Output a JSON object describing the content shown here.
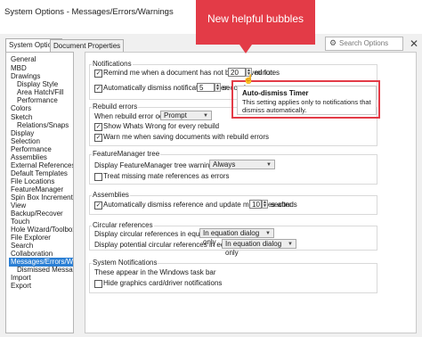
{
  "window": {
    "title": "System Options - Messages/Errors/Warnings",
    "close": "✕"
  },
  "tabs": [
    {
      "label": "System Options"
    },
    {
      "label": "Document Properties"
    }
  ],
  "search": {
    "placeholder": "Search Options",
    "icon": "gear-icon"
  },
  "sidebar": {
    "items": [
      {
        "label": "General"
      },
      {
        "label": "MBD"
      },
      {
        "label": "Drawings"
      },
      {
        "label": "Display Style"
      },
      {
        "label": "Area Hatch/Fill"
      },
      {
        "label": "Performance"
      },
      {
        "label": "Colors"
      },
      {
        "label": "Sketch"
      },
      {
        "label": "Relations/Snaps"
      },
      {
        "label": "Display"
      },
      {
        "label": "Selection"
      },
      {
        "label": "Performance"
      },
      {
        "label": "Assemblies"
      },
      {
        "label": "External References"
      },
      {
        "label": "Default Templates"
      },
      {
        "label": "File Locations"
      },
      {
        "label": "FeatureManager"
      },
      {
        "label": "Spin Box Increments"
      },
      {
        "label": "View"
      },
      {
        "label": "Backup/Recover"
      },
      {
        "label": "Touch"
      },
      {
        "label": "Hole Wizard/Toolbox"
      },
      {
        "label": "File Explorer"
      },
      {
        "label": "Search"
      },
      {
        "label": "Collaboration"
      },
      {
        "label": "Messages/Errors/Warnings"
      },
      {
        "label": "Dismissed Messages"
      },
      {
        "label": "Import"
      },
      {
        "label": "Export"
      }
    ]
  },
  "notifications": {
    "title": "Notifications",
    "remind_label": "Remind me when a document has not been saved for:",
    "remind_value": "20",
    "remind_unit": "minutes",
    "dismiss_label": "Automatically dismiss notifications after:",
    "dismiss_value": "5",
    "dismiss_unit": "seconds"
  },
  "rebuild": {
    "title": "Rebuild errors",
    "when_label": "When rebuild error occurs:",
    "when_value": "Prompt",
    "show_whats_wrong": "Show Whats Wrong for every rebuild",
    "warn_rebuild": "Warn me when saving documents with rebuild errors"
  },
  "featuremanager_tree": {
    "title": "FeatureManager tree",
    "display_label": "Display FeatureManager tree warnings:",
    "display_value": "Always",
    "treat_missing": "Treat missing mate references as errors"
  },
  "assemblies": {
    "title": "Assemblies",
    "auto_dismiss_label": "Automatically dismiss reference and update messages after:",
    "auto_dismiss_value": "10",
    "auto_dismiss_unit": "seconds"
  },
  "circular": {
    "title": "Circular references",
    "display_label": "Display circular references in equations:",
    "display_value": "In equation dialog only",
    "potential_label": "Display potential circular references in equations:",
    "potential_value": "In equation dialog only"
  },
  "system_notifications": {
    "title": "System Notifications",
    "desc": "These appear in the Windows task bar",
    "hide_graphics": "Hide graphics card/driver notifications"
  },
  "tooltip": {
    "title": "Auto-dismiss Timer",
    "body": "This setting applies only to notifications that dismiss automatically."
  },
  "callout": {
    "text": "New helpful bubbles",
    "color": "#e33b47"
  },
  "checkbox_states": {
    "remind": true,
    "dismiss": true,
    "show_whats_wrong": true,
    "warn_rebuild": true,
    "treat_missing": false,
    "assemblies_auto": true,
    "hide_graphics": false
  }
}
